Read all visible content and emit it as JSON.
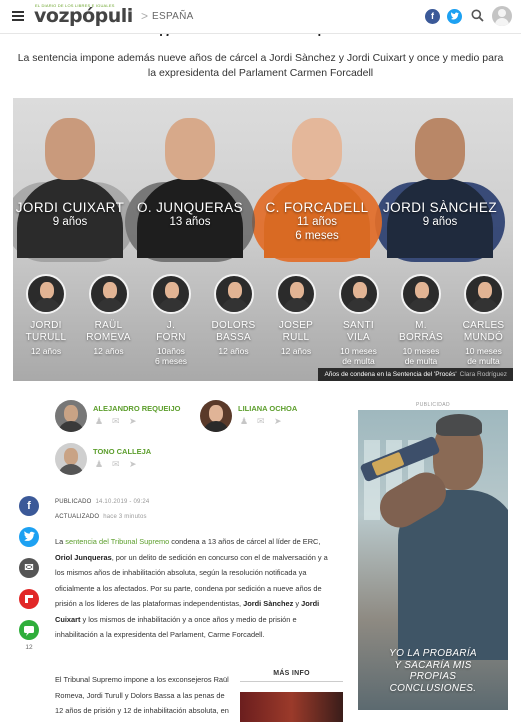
{
  "header": {
    "logo_tagline": "EL DIARIO DE LOS LIBRES E IGUALES",
    "logo_text": "vozpópuli",
    "breadcrumb_separator": ">",
    "section": "ESPAÑA",
    "facebook_glyph": "f",
    "twitter_glyph": "t"
  },
  "article": {
    "title_partial": "· · · p · · · · · · · · · · · j · · · · · ·",
    "subtitle": "La sentencia impone además nueve años de cárcel a Jordi Sànchez y Jordi Cuixart y once y medio para la expresidenta del Parlament Carmen Forcadell"
  },
  "hero": {
    "main_convicts": [
      {
        "name": "JORDI CUIXART",
        "sentence": "9 años",
        "sentence2": "",
        "face": "#c99a7c",
        "suit": "#2b2b2b",
        "disc": "rgba(120,120,120,0.45)"
      },
      {
        "name": "O. JUNQUERAS",
        "sentence": "13 años",
        "sentence2": "",
        "face": "#d7a98a",
        "suit": "#1e1e1e",
        "disc": "rgba(90,90,90,0.75)"
      },
      {
        "name": "C. FORCADELL",
        "sentence": "11 años",
        "sentence2": "6 meses",
        "face": "#e4b79a",
        "suit": "#d96a23",
        "disc": "rgba(226,108,40,0.92)"
      },
      {
        "name": "JORDI SÀNCHEZ",
        "sentence": "9 años",
        "sentence2": "",
        "face": "#b98767",
        "suit": "#1f2a3d",
        "disc": "rgba(40,60,110,0.9)"
      }
    ],
    "others": [
      {
        "line1": "JORDI",
        "line2": "TURULL",
        "sentence": "12 años",
        "sentence2": ""
      },
      {
        "line1": "RAÜL",
        "line2": "ROMEVA",
        "sentence": "12 años",
        "sentence2": ""
      },
      {
        "line1": "J.",
        "line2": "FORN",
        "sentence": "10años",
        "sentence2": "6 meses"
      },
      {
        "line1": "DOLORS",
        "line2": "BASSA",
        "sentence": "12 años",
        "sentence2": ""
      },
      {
        "line1": "JOSEP",
        "line2": "RULL",
        "sentence": "12 años",
        "sentence2": ""
      },
      {
        "line1": "SANTI",
        "line2": "VILA",
        "sentence": "10 meses",
        "sentence2": "de multa"
      },
      {
        "line1": "M.",
        "line2": "BORRÀS",
        "sentence": "10 meses",
        "sentence2": "de multa"
      },
      {
        "line1": "CARLES",
        "line2": "MUNDÓ",
        "sentence": "10 meses",
        "sentence2": "de multa"
      }
    ],
    "caption": "Años de condena en la Sentencia del 'Procés'",
    "credit": "Clara Rodríguez"
  },
  "authors": [
    {
      "name": "ALEJANDRO REQUEIJO"
    },
    {
      "name": "LILIANA OCHOA"
    },
    {
      "name": "TONO CALLEJA"
    }
  ],
  "share": {
    "count": "12",
    "colors": {
      "facebook": "#3b5998",
      "twitter": "#1da1f2",
      "email": "#555555",
      "flipboard": "#e12828",
      "comments": "#2fae3b"
    }
  },
  "meta": {
    "published_label": "PUBLICADO",
    "published_value": "14.10.2019 - 09:24",
    "updated_label": "ACTUALIZADO",
    "updated_value": "hace 3 minutos"
  },
  "body": {
    "p1_a": "La ",
    "p1_link": "sentencia del Tribunal Supremo",
    "p1_b": " condena a 13 años de cárcel al líder de ERC, ",
    "p1_bold1": "Oriol Junqueras",
    "p1_c": ", por un delito de sedición en concurso con el de malversación y a los mismos años de inhabilitación absoluta, según la resolución notificada ya oficialmente a los afectados. Por su parte, condena por sedición a nueve años de prisión a los líderes de las plataformas independentistas, ",
    "p1_bold2": "Jordi Sànchez",
    "p1_d": " y ",
    "p1_bold3": "Jordi Cuixart",
    "p1_e": " y los mismos de inhabilitación y a once años y medio de prisión e inhabilitación a la expresidenta del Parlament, Carme Forcadell.",
    "p2": "El Tribunal Supremo impone a los exconsejeros Raül Romeva, Jordi Turull y Dolors Bassa a las penas de 12 años de prisión y 12 de inhabilitación absoluta, en los"
  },
  "sidebar": {
    "mas_info": "MÁS INFO"
  },
  "ad": {
    "label": "PUBLICIDAD",
    "slogan_1": "YO LA PROBARÍA",
    "slogan_2": "Y SACARÍA MIS",
    "slogan_3": "PROPIAS",
    "slogan_4": "CONCLUSIONES."
  }
}
